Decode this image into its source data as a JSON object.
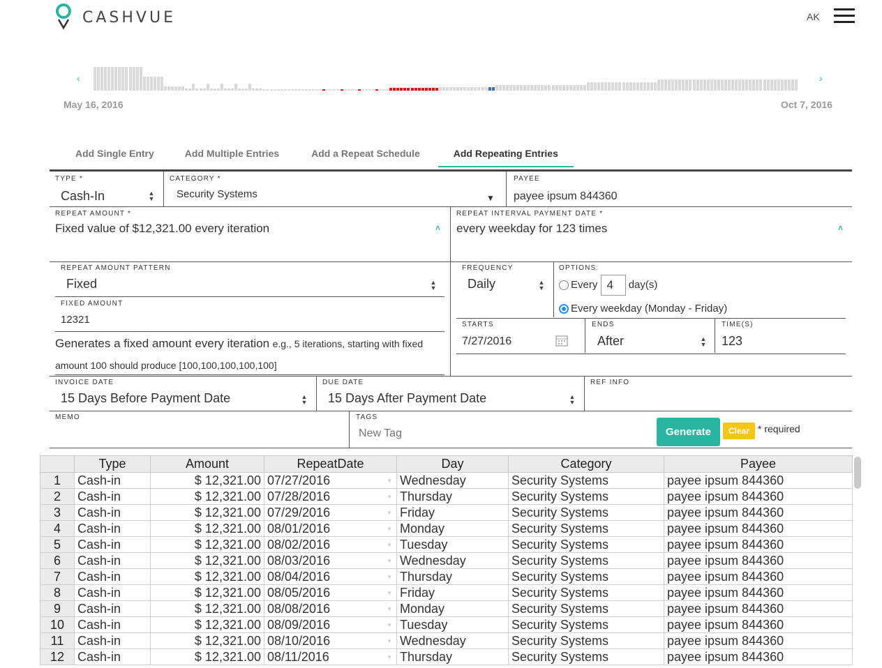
{
  "header": {
    "brand": "CASHVUE",
    "user_initials": "AK"
  },
  "timeline": {
    "start_date": "May 16, 2016",
    "end_date": "Oct 7, 2016",
    "prev_icon": "chevron-left-icon",
    "next_icon": "chevron-right-icon",
    "colors": {
      "neutral": "#d9d9d9",
      "negative": "#e01010",
      "marker": "#4a6fa5"
    }
  },
  "tabs": [
    {
      "label": "Add Single Entry"
    },
    {
      "label": "Add Multiple Entries"
    },
    {
      "label": "Add a Repeat Schedule"
    },
    {
      "label": "Add Repeating Entries",
      "active": true
    }
  ],
  "form": {
    "type": {
      "label": "TYPE *",
      "value": "Cash-In"
    },
    "category": {
      "label": "CATEGORY *",
      "value": "Security Systems"
    },
    "payee": {
      "label": "PAYEE",
      "value": "payee ipsum 844360"
    },
    "repeat_amount": {
      "label": "REPEAT AMOUNT *",
      "value": "Fixed value of $12,321.00 every iteration"
    },
    "repeat_interval": {
      "label": "REPEAT INTERVAL PAYMENT DATE *",
      "value": "every weekday for 123 times"
    },
    "amount_pattern": {
      "label": "REPEAT AMOUNT PATTERN",
      "value": "Fixed"
    },
    "fixed_amount": {
      "label": "FIXED AMOUNT",
      "value": "12321"
    },
    "help": {
      "lead": "Generates a fixed amount every iteration",
      "detail": "e.g., 5 iterations, starting with fixed amount 100 should produce [100,100,100,100,100]"
    },
    "frequency": {
      "label": "FREQUENCY",
      "value": "Daily"
    },
    "options": {
      "label": "OPTIONS:",
      "every_label": "Every",
      "every_value": "4",
      "every_unit": "day(s)",
      "weekday_label": "Every weekday (Monday - Friday)",
      "selected": "weekday"
    },
    "starts": {
      "label": "STARTS",
      "value": "7/27/2016"
    },
    "ends": {
      "label": "ENDS",
      "value": "After"
    },
    "times": {
      "label": "TIME(S)",
      "value": "123"
    },
    "invoice_date": {
      "label": "INVOICE DATE",
      "value": "15 Days Before Payment Date"
    },
    "due_date": {
      "label": "DUE DATE",
      "value": "15 Days After Payment Date"
    },
    "ref_info": {
      "label": "REF INFO",
      "value": ""
    },
    "memo": {
      "label": "MEMO",
      "value": ""
    },
    "tags": {
      "label": "TAGS",
      "placeholder": "New Tag"
    },
    "generate_label": "Generate",
    "clear_label": "Clear",
    "required_note": "* required"
  },
  "table": {
    "columns": [
      "Type",
      "Amount",
      "RepeatDate",
      "Day",
      "Category",
      "Payee"
    ],
    "rows": [
      [
        "1",
        "Cash-in",
        "$ 12,321.00",
        "07/27/2016",
        "Wednesday",
        "Security Systems",
        "payee ipsum 844360"
      ],
      [
        "2",
        "Cash-in",
        "$ 12,321.00",
        "07/28/2016",
        "Thursday",
        "Security Systems",
        "payee ipsum 844360"
      ],
      [
        "3",
        "Cash-in",
        "$ 12,321.00",
        "07/29/2016",
        "Friday",
        "Security Systems",
        "payee ipsum 844360"
      ],
      [
        "4",
        "Cash-in",
        "$ 12,321.00",
        "08/01/2016",
        "Monday",
        "Security Systems",
        "payee ipsum 844360"
      ],
      [
        "5",
        "Cash-in",
        "$ 12,321.00",
        "08/02/2016",
        "Tuesday",
        "Security Systems",
        "payee ipsum 844360"
      ],
      [
        "6",
        "Cash-in",
        "$ 12,321.00",
        "08/03/2016",
        "Wednesday",
        "Security Systems",
        "payee ipsum 844360"
      ],
      [
        "7",
        "Cash-in",
        "$ 12,321.00",
        "08/04/2016",
        "Thursday",
        "Security Systems",
        "payee ipsum 844360"
      ],
      [
        "8",
        "Cash-in",
        "$ 12,321.00",
        "08/05/2016",
        "Friday",
        "Security Systems",
        "payee ipsum 844360"
      ],
      [
        "9",
        "Cash-in",
        "$ 12,321.00",
        "08/08/2016",
        "Monday",
        "Security Systems",
        "payee ipsum 844360"
      ],
      [
        "10",
        "Cash-in",
        "$ 12,321.00",
        "08/09/2016",
        "Tuesday",
        "Security Systems",
        "payee ipsum 844360"
      ],
      [
        "11",
        "Cash-in",
        "$ 12,321.00",
        "08/10/2016",
        "Wednesday",
        "Security Systems",
        "payee ipsum 844360"
      ],
      [
        "12",
        "Cash-in",
        "$ 12,321.00",
        "08/11/2016",
        "Thursday",
        "Security Systems",
        "payee ipsum 844360"
      ]
    ]
  },
  "accent_color": "#2bb5a0"
}
